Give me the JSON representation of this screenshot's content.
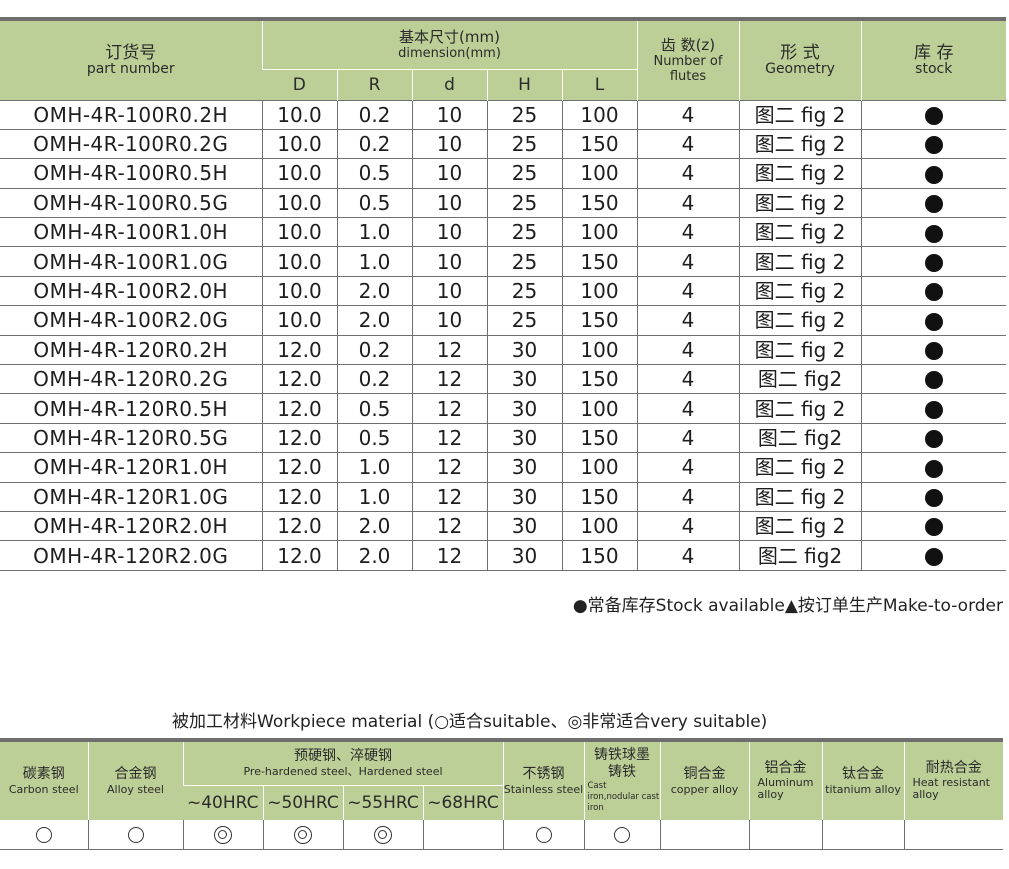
{
  "spec_table": {
    "headers": {
      "part_zh": "订货号",
      "part_en": "part number",
      "dim_zh": "基本尺寸(mm)",
      "dim_en": "dimension(mm)",
      "dim_cols": [
        "D",
        "R",
        "d",
        "H",
        "L"
      ],
      "flutes_zh": "齿 数(z)",
      "flutes_en": "Number of flutes",
      "geom_zh": "形 式",
      "geom_en": "Geometry",
      "stock_zh": "库 存",
      "stock_en": "stock"
    },
    "rows": [
      {
        "part": "OMH-4R-100R0.2H",
        "D": "10.0",
        "R": "0.2",
        "d": "10",
        "H": "25",
        "L": "100",
        "z": "4",
        "geom": "图二 fig 2",
        "stock": "●"
      },
      {
        "part": "OMH-4R-100R0.2G",
        "D": "10.0",
        "R": "0.2",
        "d": "10",
        "H": "25",
        "L": "150",
        "z": "4",
        "geom": "图二 fig 2",
        "stock": "●"
      },
      {
        "part": "OMH-4R-100R0.5H",
        "D": "10.0",
        "R": "0.5",
        "d": "10",
        "H": "25",
        "L": "100",
        "z": "4",
        "geom": "图二 fig 2",
        "stock": "●"
      },
      {
        "part": "OMH-4R-100R0.5G",
        "D": "10.0",
        "R": "0.5",
        "d": "10",
        "H": "25",
        "L": "150",
        "z": "4",
        "geom": "图二 fig 2",
        "stock": "●"
      },
      {
        "part": "OMH-4R-100R1.0H",
        "D": "10.0",
        "R": "1.0",
        "d": "10",
        "H": "25",
        "L": "100",
        "z": "4",
        "geom": "图二 fig 2",
        "stock": "●"
      },
      {
        "part": "OMH-4R-100R1.0G",
        "D": "10.0",
        "R": "1.0",
        "d": "10",
        "H": "25",
        "L": "150",
        "z": "4",
        "geom": "图二 fig 2",
        "stock": "●"
      },
      {
        "part": "OMH-4R-100R2.0H",
        "D": "10.0",
        "R": "2.0",
        "d": "10",
        "H": "25",
        "L": "100",
        "z": "4",
        "geom": "图二 fig 2",
        "stock": "●"
      },
      {
        "part": "OMH-4R-100R2.0G",
        "D": "10.0",
        "R": "2.0",
        "d": "10",
        "H": "25",
        "L": "150",
        "z": "4",
        "geom": "图二 fig 2",
        "stock": "●"
      },
      {
        "part": "OMH-4R-120R0.2H",
        "D": "12.0",
        "R": "0.2",
        "d": "12",
        "H": "30",
        "L": "100",
        "z": "4",
        "geom": "图二 fig 2",
        "stock": "●"
      },
      {
        "part": "OMH-4R-120R0.2G",
        "D": "12.0",
        "R": "0.2",
        "d": "12",
        "H": "30",
        "L": "150",
        "z": "4",
        "geom": "图二 fig2",
        "stock": "●"
      },
      {
        "part": "OMH-4R-120R0.5H",
        "D": "12.0",
        "R": "0.5",
        "d": "12",
        "H": "30",
        "L": "100",
        "z": "4",
        "geom": "图二 fig 2",
        "stock": "●"
      },
      {
        "part": "OMH-4R-120R0.5G",
        "D": "12.0",
        "R": "0.5",
        "d": "12",
        "H": "30",
        "L": "150",
        "z": "4",
        "geom": "图二 fig2",
        "stock": "●"
      },
      {
        "part": "OMH-4R-120R1.0H",
        "D": "12.0",
        "R": "1.0",
        "d": "12",
        "H": "30",
        "L": "100",
        "z": "4",
        "geom": "图二 fig 2",
        "stock": "●"
      },
      {
        "part": "OMH-4R-120R1.0G",
        "D": "12.0",
        "R": "1.0",
        "d": "12",
        "H": "30",
        "L": "150",
        "z": "4",
        "geom": "图二 fig 2",
        "stock": "●"
      },
      {
        "part": "OMH-4R-120R2.0H",
        "D": "12.0",
        "R": "2.0",
        "d": "12",
        "H": "30",
        "L": "100",
        "z": "4",
        "geom": "图二 fig 2",
        "stock": "●"
      },
      {
        "part": "OMH-4R-120R2.0G",
        "D": "12.0",
        "R": "2.0",
        "d": "12",
        "H": "30",
        "L": "150",
        "z": "4",
        "geom": "图二 fig2",
        "stock": "●"
      }
    ]
  },
  "legend": "●常备库存Stock available▲按订单生产Make-to-order",
  "material": {
    "title": "被加工材料Workpiece material (○适合suitable、◎非常适合very suitable)",
    "headers": {
      "carbon_zh": "碳素钢",
      "carbon_en": "Carbon steel",
      "alloy_zh": "合金钢",
      "alloy_en": "Alloy steel",
      "hard_zh": "预硬钢、淬硬钢",
      "hard_en": "Pre-hardened steel、Hardened steel",
      "hrc": [
        "~40HRC",
        "~50HRC",
        "~55HRC",
        "~68HRC"
      ],
      "stainless_zh": "不锈钢",
      "stainless_en": "Stainless steel",
      "cast_zh": "铸铁球墨铸铁",
      "cast_en": "Cast iron,nodular cast iron",
      "copper_zh": "铜合金",
      "copper_en": "copper alloy",
      "alu_zh": "铝合金",
      "alu_en": "Aluminum alloy",
      "ti_zh": "钛合金",
      "ti_en": "titanium alloy",
      "heat_zh": "耐热合金",
      "heat_en": "Heat resistant alloy"
    },
    "ratings": [
      "○",
      "○",
      "◎",
      "◎",
      "◎",
      "",
      "○",
      "○",
      "",
      "",
      "",
      ""
    ]
  }
}
